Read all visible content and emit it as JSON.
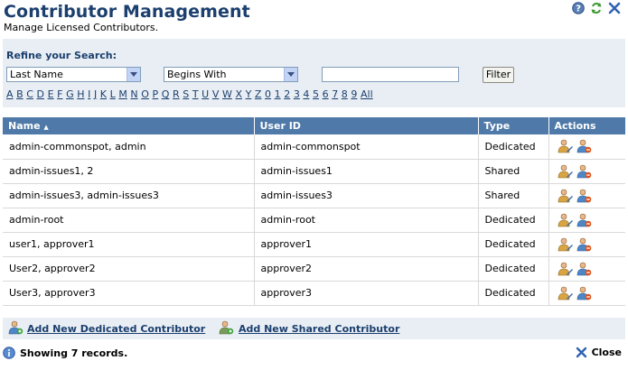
{
  "header": {
    "title": "Contributor Management",
    "subtitle": "Manage Licensed Contributors."
  },
  "top_icons": [
    "help-icon",
    "refresh-icon",
    "close-icon"
  ],
  "refine": {
    "label": "Refine your Search:",
    "field_select": "Last Name",
    "match_select": "Begins With",
    "search_value": "",
    "filter_label": "Filter"
  },
  "alphabet": [
    "A",
    "B",
    "C",
    "D",
    "E",
    "F",
    "G",
    "H",
    "I",
    "J",
    "K",
    "L",
    "M",
    "N",
    "O",
    "P",
    "Q",
    "R",
    "S",
    "T",
    "U",
    "V",
    "W",
    "X",
    "Y",
    "Z",
    "0",
    "1",
    "2",
    "3",
    "4",
    "5",
    "6",
    "7",
    "8",
    "9",
    "All"
  ],
  "table": {
    "columns": [
      "Name",
      "User ID",
      "Type",
      "Actions"
    ],
    "sort_indicator": "▲",
    "rows": [
      {
        "name": "admin-commonspot, admin",
        "user_id": "admin-commonspot",
        "type": "Dedicated"
      },
      {
        "name": "admin-issues1, 2",
        "user_id": "admin-issues1",
        "type": "Shared"
      },
      {
        "name": "admin-issues3, admin-issues3",
        "user_id": "admin-issues3",
        "type": "Shared"
      },
      {
        "name": "admin-root",
        "user_id": "admin-root",
        "type": "Dedicated"
      },
      {
        "name": "user1, approver1",
        "user_id": "approver1",
        "type": "Dedicated"
      },
      {
        "name": "User2, approver2",
        "user_id": "approver2",
        "type": "Dedicated"
      },
      {
        "name": "User3, approver3",
        "user_id": "approver3",
        "type": "Dedicated"
      }
    ]
  },
  "footer": {
    "add_dedicated": "Add New Dedicated Contributor",
    "add_shared": "Add New Shared Contributor",
    "status": "Showing 7 records.",
    "close": "Close"
  },
  "colors": {
    "title": "#1b3f6e",
    "header_bg": "#4e79a8",
    "panel_bg": "#e9eef4"
  }
}
